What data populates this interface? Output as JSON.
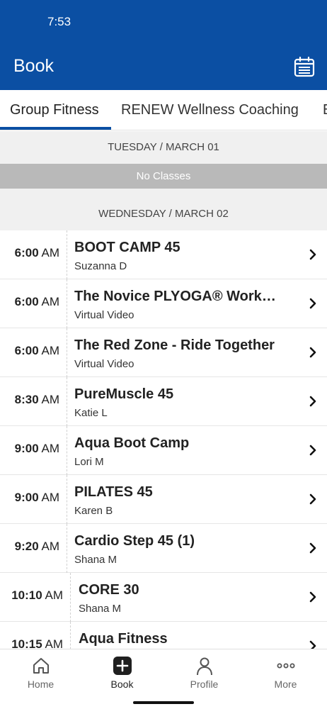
{
  "status_bar": {
    "time": "7:53"
  },
  "header": {
    "title": "Book",
    "calendar_icon": "calendar-icon"
  },
  "tabs": [
    {
      "label": "Group Fitness",
      "active": true
    },
    {
      "label": "RENEW Wellness Coaching",
      "active": false
    },
    {
      "label": "E",
      "active": false
    }
  ],
  "days": [
    {
      "label": "TUESDAY / MARCH 01",
      "empty_text": "No Classes"
    },
    {
      "label": "WEDNESDAY / MARCH 02"
    }
  ],
  "classes": [
    {
      "time": "6:00",
      "ampm": "AM",
      "name": "BOOT CAMP 45",
      "instructor": "Suzanna D"
    },
    {
      "time": "6:00",
      "ampm": "AM",
      "name": "The Novice PLYOGA® Workshop",
      "instructor": "Virtual Video"
    },
    {
      "time": "6:00",
      "ampm": "AM",
      "name": "The Red Zone - Ride Together",
      "instructor": "Virtual Video"
    },
    {
      "time": "8:30",
      "ampm": "AM",
      "name": "PureMuscle 45",
      "instructor": "Katie L"
    },
    {
      "time": "9:00",
      "ampm": "AM",
      "name": "Aqua Boot Camp",
      "instructor": "Lori M"
    },
    {
      "time": "9:00",
      "ampm": "AM",
      "name": "PILATES 45",
      "instructor": "Karen B"
    },
    {
      "time": "9:20",
      "ampm": "AM",
      "name": "Cardio Step 45 (1)",
      "instructor": "Shana M"
    },
    {
      "time": "10:10",
      "ampm": "AM",
      "name": "CORE 30",
      "instructor": "Shana M"
    },
    {
      "time": "10:15",
      "ampm": "AM",
      "name": "Aqua Fitness",
      "instructor": ""
    }
  ],
  "bottom_nav": [
    {
      "label": "Home",
      "icon": "home-icon",
      "active": false
    },
    {
      "label": "Book",
      "icon": "plus-icon",
      "active": true
    },
    {
      "label": "Profile",
      "icon": "person-icon",
      "active": false
    },
    {
      "label": "More",
      "icon": "more-icon",
      "active": false
    }
  ],
  "colors": {
    "brand": "#0b4fa3",
    "no_classes_bg": "#b9b9b9",
    "section_bg": "#f0f0f0"
  }
}
